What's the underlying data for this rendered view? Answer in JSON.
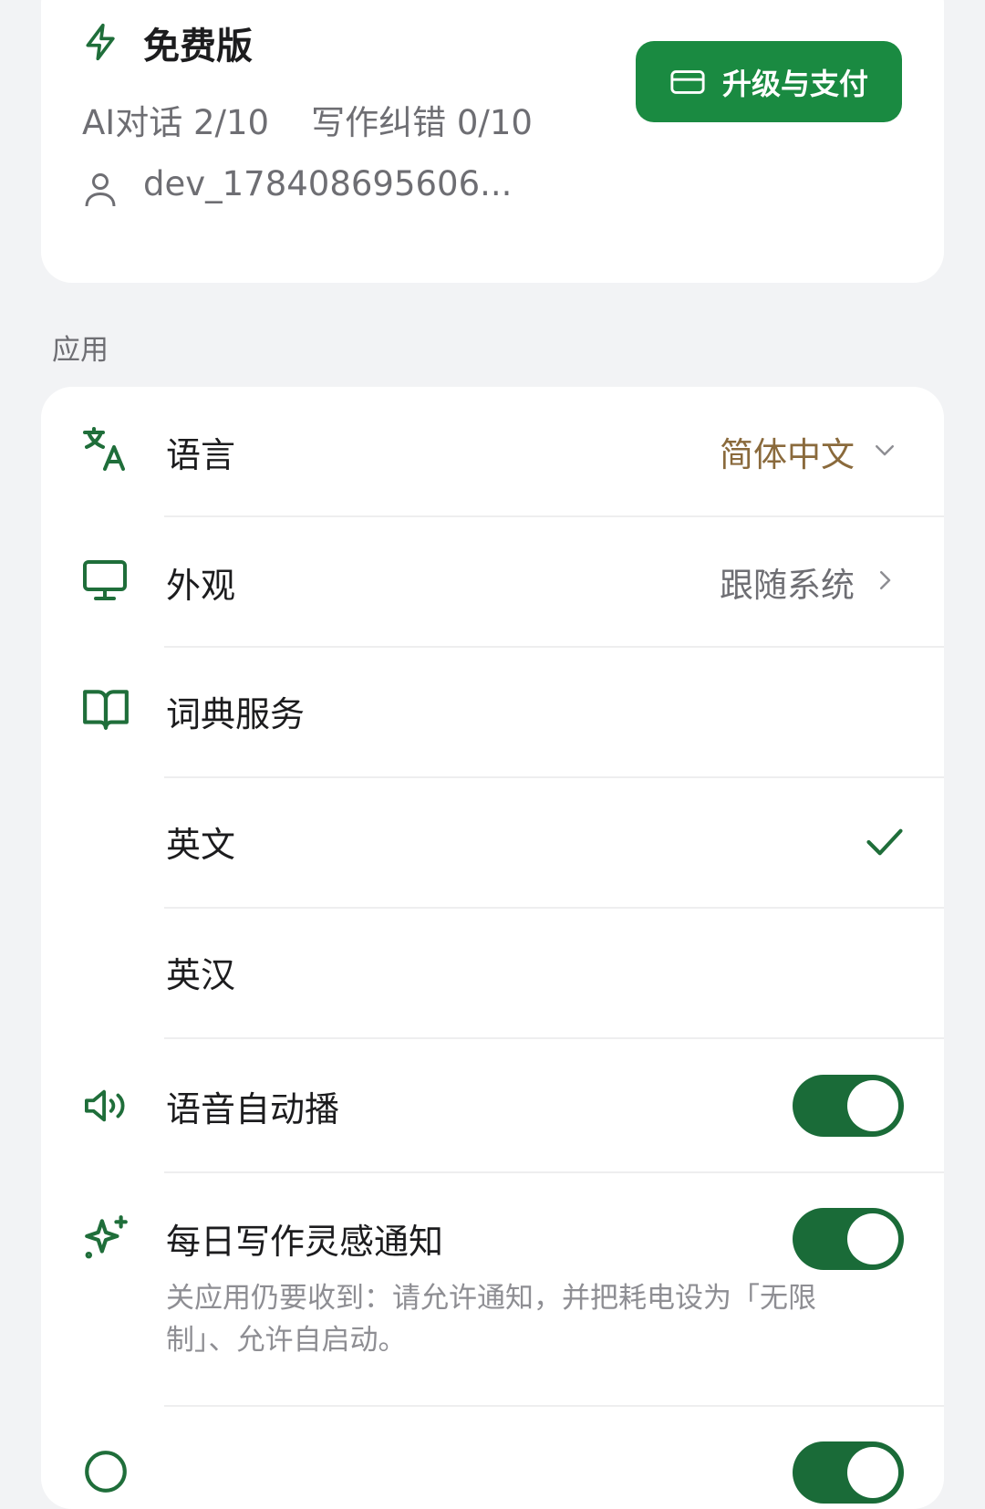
{
  "plan": {
    "title": "免费版",
    "quota_chat": "AI对话 2/10",
    "quota_writing": "写作纠错 0/10",
    "user_id": "dev_178408695606...",
    "upgrade_label": "升级与支付"
  },
  "section": {
    "label": "应用"
  },
  "settings": {
    "language": {
      "label": "语言",
      "value": "简体中文"
    },
    "appearance": {
      "label": "外观",
      "value": "跟随系统"
    },
    "dictionary": {
      "label": "词典服务"
    },
    "dict_en": {
      "label": "英文"
    },
    "dict_en_zh": {
      "label": "英汉"
    },
    "autoplay": {
      "label": "语音自动播"
    },
    "daily_notice": {
      "label": "每日写作灵感通知",
      "hint": "关应用仍要收到：请允许通知，并把耗电设为「无限制」、允许自启动。"
    }
  },
  "colors": {
    "accent": "#1a8a41",
    "toggle_on": "#1a6b38",
    "icon": "#1f6e3a",
    "language_value": "#8a6a3c",
    "background": "#f2f3f5"
  }
}
